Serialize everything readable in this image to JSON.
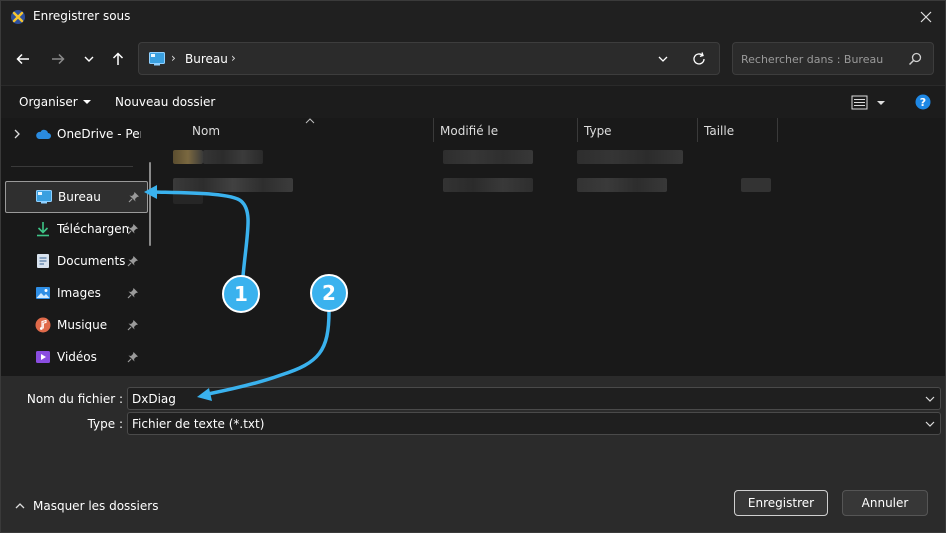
{
  "window": {
    "title": "Enregistrer sous",
    "close_glyph": "✕"
  },
  "nav": {
    "back_icon": "arrow-left-icon",
    "forward_icon": "arrow-right-icon",
    "recent_icon": "chevron-down-icon",
    "up_icon": "arrow-up-icon"
  },
  "address": {
    "sep": "›",
    "crumb": "Bureau"
  },
  "search": {
    "placeholder": "Rechercher dans : Bureau"
  },
  "toolbar": {
    "organiser": "Organiser",
    "nouveau_dossier": "Nouveau dossier",
    "help": "?"
  },
  "sidebar": {
    "onedrive": "OneDrive - Perso",
    "items": [
      {
        "label": "Bureau",
        "icon": "desktop-icon"
      },
      {
        "label": "Téléchargements",
        "icon": "download-icon"
      },
      {
        "label": "Documents",
        "icon": "documents-icon"
      },
      {
        "label": "Images",
        "icon": "images-icon"
      },
      {
        "label": "Musique",
        "icon": "music-icon"
      },
      {
        "label": "Vidéos",
        "icon": "videos-icon"
      }
    ]
  },
  "columns": {
    "name": "Nom",
    "modified": "Modifié le",
    "type": "Type",
    "size": "Taille"
  },
  "form": {
    "filename_label": "Nom du fichier :",
    "filename_value": "DxDiag",
    "type_label": "Type :",
    "type_value": "Fichier de texte (*.txt)"
  },
  "footer": {
    "hide_folders": "Masquer les dossiers",
    "save": "Enregistrer",
    "cancel": "Annuler"
  },
  "annotations": {
    "badge1": "1",
    "badge2": "2"
  },
  "colors": {
    "accent": "#3ab2ee",
    "background": "#202020",
    "pane": "#191919",
    "bottom": "#2b2b2b"
  }
}
